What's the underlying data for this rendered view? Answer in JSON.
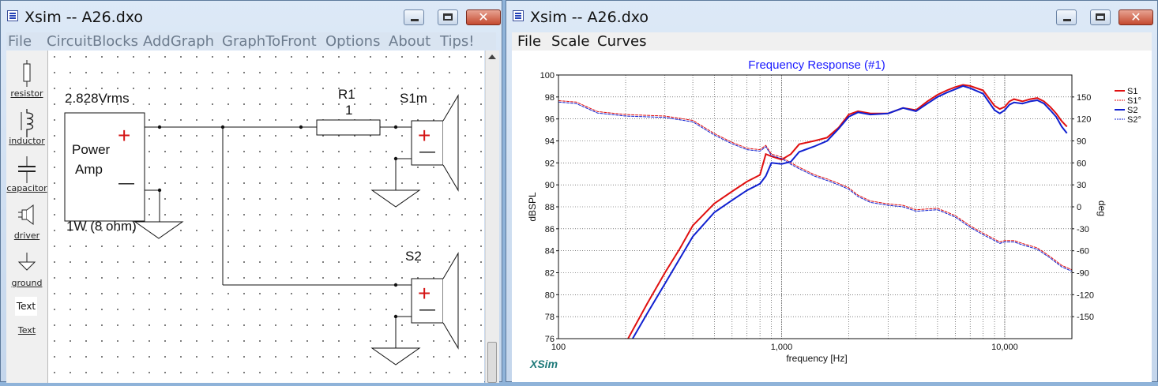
{
  "schematic_window": {
    "title": "Xsim -- A26.dxo",
    "menu": [
      "File",
      "CircuitBlocks",
      "AddGraph",
      "GraphToFront",
      "Options",
      "About",
      "Tips!"
    ],
    "palette": [
      {
        "label": "resistor",
        "icon": "resistor-icon"
      },
      {
        "label": "inductor",
        "icon": "inductor-icon"
      },
      {
        "label": "capacitor",
        "icon": "capacitor-icon"
      },
      {
        "label": "driver",
        "icon": "driver-icon"
      },
      {
        "label": "ground",
        "icon": "ground-icon"
      },
      {
        "label": "Text",
        "icon": "text-icon",
        "badge": "Text"
      }
    ],
    "circuit": {
      "voltage_label": "2.828Vrms",
      "amp_line1": "Power",
      "amp_line2": "Amp",
      "power_label": "1W (8 ohm)",
      "resistor_name": "R1",
      "resistor_value": "1",
      "speaker1_name": "S1m",
      "speaker2_name": "S2",
      "plus": "+",
      "minus": "—"
    }
  },
  "graph_window": {
    "title": "Xsim -- A26.dxo",
    "menu": [
      "File",
      "Scale",
      "Curves"
    ],
    "watermark": "XSim"
  },
  "chart_data": {
    "type": "line",
    "title": "Frequency Response (#1)",
    "xlabel": "frequency [Hz]",
    "ylabel": "dBSPL",
    "y2label": "deg",
    "xscale": "log",
    "xlim": [
      100,
      20000
    ],
    "ylim": [
      76,
      100
    ],
    "y2lim": [
      -180,
      180
    ],
    "x_ticks": [
      "100",
      "1,000",
      "10,000"
    ],
    "y_ticks": [
      "100",
      "98",
      "96",
      "94",
      "92",
      "90",
      "88",
      "86",
      "84",
      "82",
      "80",
      "78",
      "76"
    ],
    "y2_ticks": [
      "150",
      "120",
      "90",
      "60",
      "30",
      "0",
      "-30",
      "-60",
      "-90",
      "-120",
      "-150"
    ],
    "grid": true,
    "legend_position": "top-right",
    "colors": {
      "S1": "#e01010",
      "S1p": "#e01010",
      "S2": "#1020d0",
      "S2p": "#1020d0"
    },
    "series": [
      {
        "name": "S1",
        "axis": "left",
        "style": "solid",
        "x": [
          205,
          250,
          300,
          350,
          400,
          500,
          600,
          700,
          800,
          850,
          900,
          1000,
          1100,
          1200,
          1400,
          1600,
          1800,
          2000,
          2200,
          2500,
          3000,
          3500,
          4000,
          4500,
          5000,
          5500,
          6000,
          6500,
          7000,
          8000,
          9000,
          9500,
          10000,
          10500,
          11000,
          12000,
          13000,
          14000,
          15000,
          16000,
          17000,
          18000,
          19000
        ],
        "y": [
          76,
          79.2,
          82,
          84.2,
          86.3,
          88.3,
          89.4,
          90.3,
          90.9,
          92.8,
          92.6,
          92.3,
          92.8,
          93.7,
          94,
          94.3,
          95.2,
          96.4,
          96.7,
          96.5,
          96.5,
          97,
          96.8,
          97.6,
          98.2,
          98.6,
          98.9,
          99.1,
          99,
          98.6,
          97.2,
          96.9,
          97.1,
          97.6,
          97.8,
          97.6,
          97.8,
          97.9,
          97.6,
          97.1,
          96.5,
          95.8,
          95.3
        ]
      },
      {
        "name": "S1°",
        "axis": "right",
        "style": "dashed",
        "x": [
          100,
          120,
          150,
          200,
          300,
          400,
          500,
          600,
          700,
          800,
          850,
          900,
          1000,
          1100,
          1200,
          1400,
          1600,
          1800,
          2000,
          2200,
          2500,
          3000,
          3500,
          4000,
          5000,
          6000,
          7000,
          8000,
          9000,
          9500,
          10000,
          11000,
          12000,
          14000,
          16000,
          18000,
          20000
        ],
        "y": [
          145,
          143,
          130,
          126,
          124,
          118,
          100,
          88,
          80,
          78,
          84,
          72,
          68,
          60,
          54,
          44,
          38,
          32,
          26,
          16,
          8,
          4,
          2,
          -4,
          -2,
          -12,
          -26,
          -36,
          -44,
          -48,
          -46,
          -46,
          -50,
          -56,
          -68,
          -80,
          -86
        ]
      },
      {
        "name": "S2",
        "axis": "left",
        "style": "solid",
        "x": [
          215,
          250,
          300,
          350,
          400,
          500,
          600,
          700,
          800,
          850,
          900,
          1000,
          1100,
          1200,
          1400,
          1600,
          1800,
          2000,
          2200,
          2500,
          3000,
          3500,
          4000,
          4500,
          5000,
          5500,
          6000,
          6500,
          7000,
          8000,
          9000,
          9500,
          10000,
          10500,
          11000,
          12000,
          13000,
          14000,
          15000,
          16000,
          17000,
          18000,
          19000
        ],
        "y": [
          76,
          78.3,
          81,
          83.3,
          85.3,
          87.5,
          88.6,
          89.5,
          90.1,
          90.8,
          92,
          91.9,
          92.1,
          93,
          93.5,
          94,
          95.1,
          96.2,
          96.6,
          96.4,
          96.5,
          97,
          96.7,
          97.4,
          98,
          98.4,
          98.7,
          99,
          98.8,
          98.3,
          96.8,
          96.5,
          96.8,
          97.3,
          97.5,
          97.4,
          97.6,
          97.7,
          97.4,
          96.8,
          96.2,
          95.3,
          94.7
        ]
      },
      {
        "name": "S2°",
        "axis": "right",
        "style": "dashed",
        "x": [
          100,
          120,
          150,
          200,
          300,
          400,
          500,
          600,
          700,
          800,
          850,
          900,
          1000,
          1100,
          1200,
          1400,
          1600,
          1800,
          2000,
          2200,
          2500,
          3000,
          3500,
          4000,
          5000,
          6000,
          7000,
          8000,
          9000,
          9500,
          10000,
          11000,
          12000,
          14000,
          16000,
          18000,
          20000
        ],
        "y": [
          143,
          141,
          128,
          124,
          122,
          116,
          98,
          86,
          78,
          76,
          82,
          70,
          66,
          58,
          52,
          42,
          36,
          30,
          24,
          14,
          6,
          2,
          0,
          -6,
          -4,
          -14,
          -28,
          -38,
          -46,
          -50,
          -48,
          -48,
          -52,
          -58,
          -70,
          -82,
          -88
        ]
      }
    ]
  }
}
